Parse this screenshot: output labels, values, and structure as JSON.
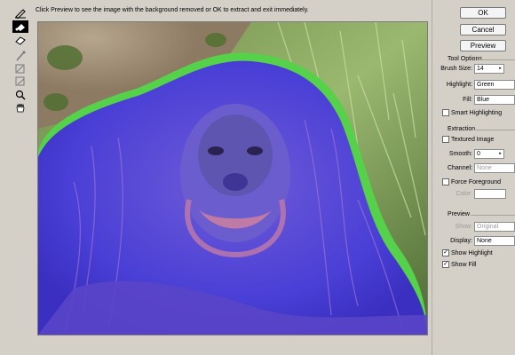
{
  "hint": "Click Preview to see the image with the background removed or OK to extract and exit immediately.",
  "toolbar": {
    "tools": [
      "edge-highlighter",
      "fill",
      "eraser",
      "eyedropper",
      "cleanup",
      "edge-touchup",
      "zoom",
      "hand"
    ]
  },
  "buttons": {
    "ok": "OK",
    "cancel": "Cancel",
    "preview": "Preview"
  },
  "tool_options": {
    "title": "Tool Options",
    "brush_size_label": "Brush Size:",
    "brush_size": "14",
    "highlight_label": "Highlight:",
    "highlight": "Green",
    "fill_label": "Fill:",
    "fill": "Blue",
    "smart_highlighting_label": "Smart Highlighting"
  },
  "extraction": {
    "title": "Extraction",
    "textured_image_label": "Textured Image",
    "smooth_label": "Smooth:",
    "smooth": "0",
    "channel_label": "Channel:",
    "channel": "None",
    "force_foreground_label": "Force Foreground",
    "color_label": "Color:"
  },
  "preview_section": {
    "title": "Preview",
    "show_label": "Show:",
    "show": "Original",
    "display_label": "Display:",
    "display": "None",
    "show_highlight_label": "Show Highlight",
    "show_fill_label": "Show Fill"
  },
  "colors": {
    "highlight": "#55d14a",
    "fill": "#4a3fd6"
  }
}
